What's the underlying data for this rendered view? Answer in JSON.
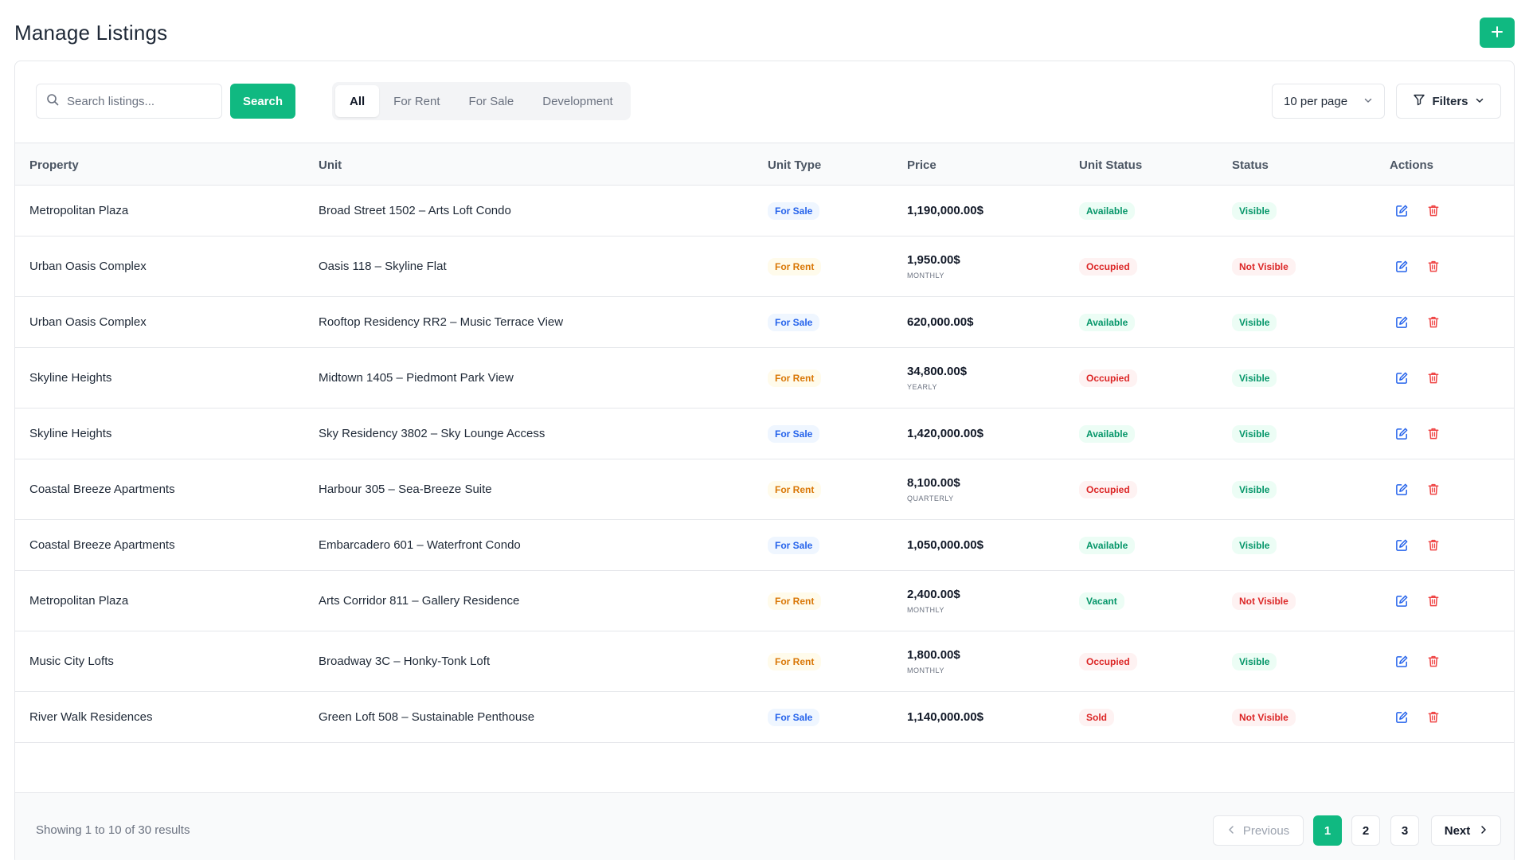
{
  "header": {
    "title": "Manage Listings",
    "add_icon": "plus-icon"
  },
  "toolbar": {
    "search_placeholder": "Search listings...",
    "search_label": "Search",
    "tabs": [
      {
        "label": "All",
        "active": true
      },
      {
        "label": "For Rent",
        "active": false
      },
      {
        "label": "For Sale",
        "active": false
      },
      {
        "label": "Development",
        "active": false
      }
    ],
    "per_page": "10 per page",
    "filters_label": "Filters"
  },
  "table": {
    "columns": [
      "Property",
      "Unit",
      "Unit Type",
      "Price",
      "Unit Status",
      "Status",
      "Actions"
    ],
    "rows": [
      {
        "property": "Metropolitan Plaza",
        "unit": "Broad Street 1502 – Arts Loft Condo",
        "unit_type": "For Sale",
        "price": "1,190,000.00$",
        "period": "",
        "unit_status": "Available",
        "status": "Visible"
      },
      {
        "property": "Urban Oasis Complex",
        "unit": "Oasis 118 – Skyline Flat",
        "unit_type": "For Rent",
        "price": "1,950.00$",
        "period": "MONTHLY",
        "unit_status": "Occupied",
        "status": "Not Visible"
      },
      {
        "property": "Urban Oasis Complex",
        "unit": "Rooftop Residency RR2 – Music Terrace View",
        "unit_type": "For Sale",
        "price": "620,000.00$",
        "period": "",
        "unit_status": "Available",
        "status": "Visible"
      },
      {
        "property": "Skyline Heights",
        "unit": "Midtown 1405 – Piedmont Park View",
        "unit_type": "For Rent",
        "price": "34,800.00$",
        "period": "YEARLY",
        "unit_status": "Occupied",
        "status": "Visible"
      },
      {
        "property": "Skyline Heights",
        "unit": "Sky Residency 3802 – Sky Lounge Access",
        "unit_type": "For Sale",
        "price": "1,420,000.00$",
        "period": "",
        "unit_status": "Available",
        "status": "Visible"
      },
      {
        "property": "Coastal Breeze Apartments",
        "unit": "Harbour 305 – Sea-Breeze Suite",
        "unit_type": "For Rent",
        "price": "8,100.00$",
        "period": "QUARTERLY",
        "unit_status": "Occupied",
        "status": "Visible"
      },
      {
        "property": "Coastal Breeze Apartments",
        "unit": "Embarcadero 601 – Waterfront Condo",
        "unit_type": "For Sale",
        "price": "1,050,000.00$",
        "period": "",
        "unit_status": "Available",
        "status": "Visible"
      },
      {
        "property": "Metropolitan Plaza",
        "unit": "Arts Corridor 811 – Gallery Residence",
        "unit_type": "For Rent",
        "price": "2,400.00$",
        "period": "MONTHLY",
        "unit_status": "Vacant",
        "status": "Not Visible"
      },
      {
        "property": "Music City Lofts",
        "unit": "Broadway 3C – Honky-Tonk Loft",
        "unit_type": "For Rent",
        "price": "1,800.00$",
        "period": "MONTHLY",
        "unit_status": "Occupied",
        "status": "Visible"
      },
      {
        "property": "River Walk Residences",
        "unit": "Green Loft 508 – Sustainable Penthouse",
        "unit_type": "For Sale",
        "price": "1,140,000.00$",
        "period": "",
        "unit_status": "Sold",
        "status": "Not Visible"
      }
    ],
    "action_icons": [
      "edit-icon",
      "trash-icon"
    ]
  },
  "footer": {
    "showing": "Showing 1 to 10 of 30 results",
    "previous": "Previous",
    "pages": [
      "1",
      "2",
      "3"
    ],
    "current_page": "1",
    "next": "Next"
  },
  "colors": {
    "accent": "#10b981",
    "sale_badge": "#2563eb",
    "rent_badge": "#d97706",
    "positive": "#059669",
    "negative": "#dc2626",
    "edit_icon": "#2563eb",
    "delete_icon": "#ef4444"
  }
}
